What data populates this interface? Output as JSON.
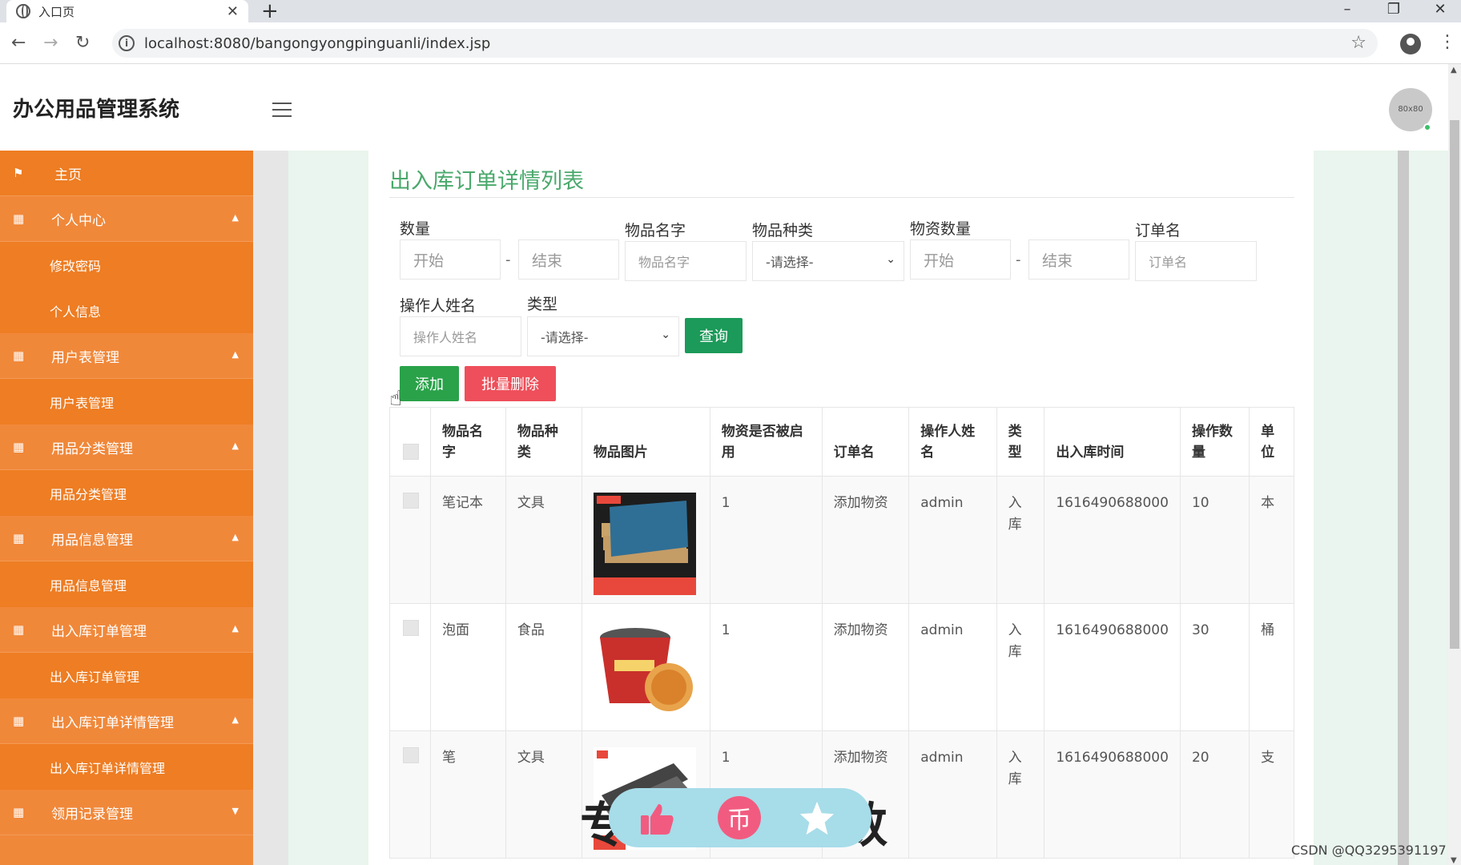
{
  "browser": {
    "tab_title": "入口页",
    "url": "localhost:8080/bangongyongpinguanli/index.jsp"
  },
  "header": {
    "app_title": "办公用品管理系统",
    "avatar_text": "80x80"
  },
  "sidebar": {
    "home": "主页",
    "groups": [
      {
        "label": "个人中心",
        "subs": [
          "修改密码",
          "个人信息"
        ]
      },
      {
        "label": "用户表管理",
        "subs": [
          "用户表管理"
        ]
      },
      {
        "label": "用品分类管理",
        "subs": [
          "用品分类管理"
        ]
      },
      {
        "label": "用品信息管理",
        "subs": [
          "用品信息管理"
        ]
      },
      {
        "label": "出入库订单管理",
        "subs": [
          "出入库订单管理"
        ]
      },
      {
        "label": "出入库订单详情管理",
        "subs": [
          "出入库订单详情管理"
        ]
      },
      {
        "label": "领用记录管理",
        "subs": []
      }
    ]
  },
  "main": {
    "title": "出入库订单详情列表",
    "filters": {
      "quantity_label": "数量",
      "quantity_start_ph": "开始",
      "quantity_end_ph": "结束",
      "name_label": "物品名字",
      "name_ph": "物品名字",
      "category_label": "物品种类",
      "category_value": "-请选择-",
      "stock_label": "物资数量",
      "stock_start_ph": "开始",
      "stock_end_ph": "结束",
      "order_label": "订单名",
      "order_ph": "订单名",
      "operator_label": "操作人姓名",
      "operator_ph": "操作人姓名",
      "type_label": "类型",
      "type_value": "-请选择-",
      "dash": "-",
      "query_button": "查询"
    },
    "actions": {
      "add": "添加",
      "batch_delete": "批量删除"
    },
    "table": {
      "headers": [
        "物品名字",
        "物品种类",
        "物品图片",
        "物资是否被启用",
        "订单名",
        "操作人姓名",
        "类型",
        "出入库时间",
        "操作数量",
        "单位"
      ],
      "rows": [
        {
          "name": "笔记本",
          "category": "文具",
          "enabled": "1",
          "order": "添加物资",
          "operator": "admin",
          "type": "入库",
          "time": "1616490688000",
          "qty": "10",
          "unit": "本"
        },
        {
          "name": "泡面",
          "category": "食品",
          "enabled": "1",
          "order": "添加物资",
          "operator": "admin",
          "type": "入库",
          "time": "1616490688000",
          "qty": "30",
          "unit": "桶"
        },
        {
          "name": "笔",
          "category": "文具",
          "enabled": "1",
          "order": "添加物资",
          "operator": "admin",
          "type": "入库",
          "time": "1616490688000",
          "qty": "20",
          "unit": "支"
        }
      ]
    }
  },
  "overlay": {
    "left_char": "专",
    "right_char": "数",
    "watermark": "CSDN @QQ3295391197"
  },
  "colors": {
    "sidebar": "#f0883a",
    "accent_green": "#4aa96c",
    "query_button": "#1b9a59",
    "add_button": "#2aa24a",
    "delete_button": "#ee4f5a"
  },
  "icons": [
    "globe-icon",
    "close-icon",
    "plus-icon",
    "back-icon",
    "forward-icon",
    "reload-icon",
    "info-icon",
    "star-icon",
    "profile-icon",
    "menu-icon",
    "flag-icon",
    "grid-icon",
    "caret-up-icon",
    "thumbs-up-icon",
    "coin-icon"
  ]
}
